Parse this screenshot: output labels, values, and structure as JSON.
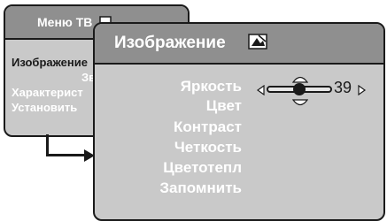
{
  "menu": {
    "title": "Меню ТВ",
    "items": [
      {
        "label": "Изображение",
        "selected": true
      },
      {
        "label": "Звук",
        "selected": false
      },
      {
        "label": "Характерист",
        "selected": false
      },
      {
        "label": "Установить",
        "selected": false
      }
    ]
  },
  "submenu": {
    "title": "Изображение",
    "items": [
      {
        "label": "Яркость",
        "selected": true
      },
      {
        "label": "Цвет"
      },
      {
        "label": "Контраст"
      },
      {
        "label": "Четкость"
      },
      {
        "label": "Цветотепл"
      },
      {
        "label": "Запомнить"
      }
    ],
    "slider": {
      "value": "39",
      "level": 0.39
    }
  },
  "icons": {
    "menu": "tv-icon",
    "submenu": "picture-icon",
    "slider_left": "speaker-left-icon",
    "slider_right": "speaker-right-icon"
  },
  "colors": {
    "panel": "#c9c9c9",
    "titlebar": "#8f8f8f",
    "border": "#1a1a1a",
    "text_active": "#1a1a1a",
    "text": "#ffffff"
  }
}
